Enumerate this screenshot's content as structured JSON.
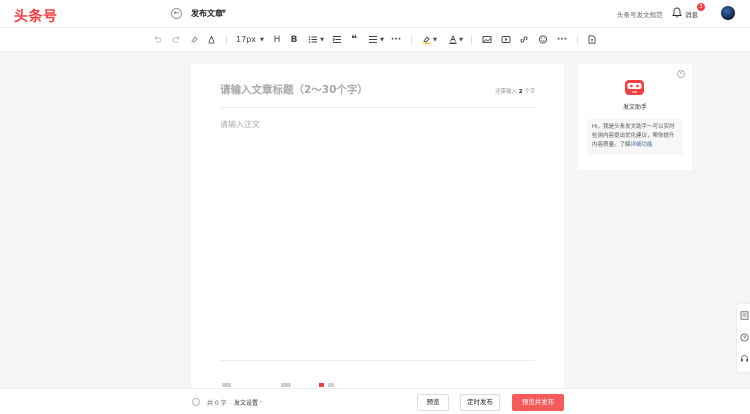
{
  "header": {
    "logo": "头条号",
    "back": "←",
    "title": "发布文章",
    "title_caret": "▼",
    "norms_link": "头条号发文规范",
    "messages": {
      "label": "消息",
      "badge": "3"
    }
  },
  "toolbar": {
    "font_size": "17px",
    "heading": "H",
    "bold": "B",
    "quote": "❝",
    "more1": "···",
    "more2": "···"
  },
  "editor": {
    "title_placeholder": "请输入文章标题（2～30个字）",
    "title_hint_prefix": "还需输入",
    "title_hint_count": "2",
    "title_hint_suffix": "个字",
    "body_placeholder": "请输入正文"
  },
  "assistant": {
    "close": "×",
    "name": "发文助手",
    "text": "Hi，我是头条发文助手～可以实时检测内容提出优化建议，帮你提升内容质量。",
    "link_prefix": "了解",
    "link": "详细功能"
  },
  "bottom": {
    "word_count": "共 0 字",
    "settings": "发文设置",
    "settings_caret": "⌄",
    "preview": "预览",
    "schedule": "定时发布",
    "publish": "预览并发布"
  },
  "colors": {
    "brand": "#f04142",
    "primary_button": "#f65a5a",
    "link": "#406599"
  }
}
